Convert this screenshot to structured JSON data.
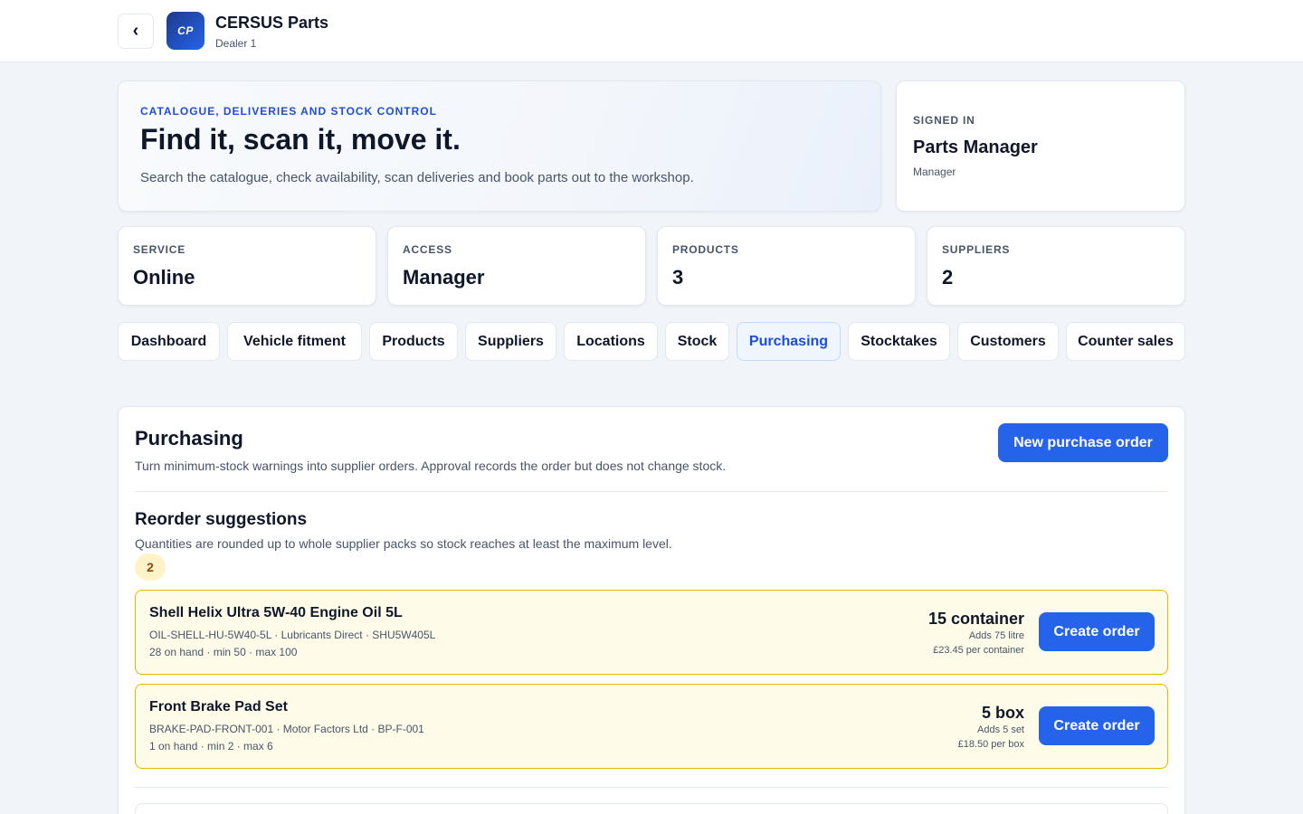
{
  "header": {
    "back_label": "‹",
    "logo_text": "CP",
    "app_title": "CERSUS Parts",
    "dealer": "Dealer 1"
  },
  "hero": {
    "eyebrow": "CATALOGUE, DELIVERIES AND STOCK CONTROL",
    "headline": "Find it, scan it, move it.",
    "description": "Search the catalogue, check availability, scan deliveries and book parts out to the workshop."
  },
  "signed_in": {
    "label": "SIGNED IN",
    "name": "Parts Manager",
    "role": "Manager"
  },
  "stats": [
    {
      "label": "SERVICE",
      "value": "Online"
    },
    {
      "label": "ACCESS",
      "value": "Manager"
    },
    {
      "label": "PRODUCTS",
      "value": "3"
    },
    {
      "label": "SUPPLIERS",
      "value": "2"
    }
  ],
  "tabs": [
    {
      "label": "Dashboard"
    },
    {
      "label": "Vehicle fitment"
    },
    {
      "label": "Products"
    },
    {
      "label": "Suppliers"
    },
    {
      "label": "Locations"
    },
    {
      "label": "Stock"
    },
    {
      "label": "Purchasing",
      "active": true
    },
    {
      "label": "Stocktakes"
    },
    {
      "label": "Customers"
    },
    {
      "label": "Counter sales"
    }
  ],
  "purchasing": {
    "title": "Purchasing",
    "subtitle": "Turn minimum-stock warnings into supplier orders. Approval records the order but does not change stock.",
    "new_order_label": "New purchase order",
    "reorder": {
      "title": "Reorder suggestions",
      "description": "Quantities are rounded up to whole supplier packs so stock reaches at least the maximum level.",
      "count": "2",
      "items": [
        {
          "name": "Shell Helix Ultra 5W-40 Engine Oil 5L",
          "meta": "OIL-SHELL-HU-5W40-5L · Lubricants Direct · SHU5W405L",
          "stock": "28 on hand · min 50 · max 100",
          "quantity": "15 container",
          "adds": "Adds 75 litre",
          "price": "£23.45 per container",
          "action": "Create order"
        },
        {
          "name": "Front Brake Pad Set",
          "meta": "BRAKE-PAD-FRONT-001 · Motor Factors Ltd · BP-F-001",
          "stock": "1 on hand · min 2 · max 6",
          "quantity": "5 box",
          "adds": "Adds 5 set",
          "price": "£18.50 per box",
          "action": "Create order"
        }
      ]
    }
  },
  "colors": {
    "accent": "#2563eb",
    "active_tab_text": "#1d4ed8",
    "warning_bg": "#fefce8",
    "warning_border": "#eab308",
    "page_bg": "#f1f5f9"
  }
}
